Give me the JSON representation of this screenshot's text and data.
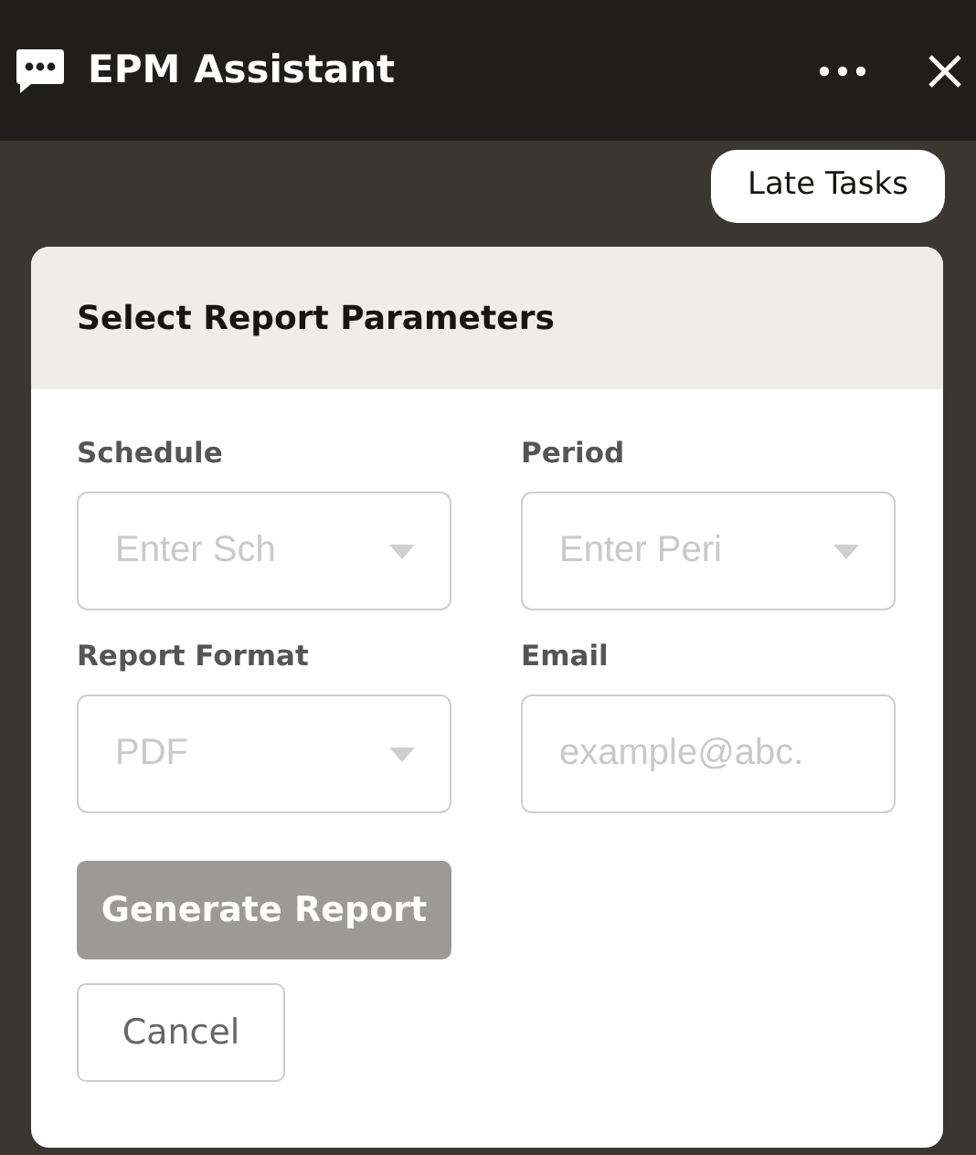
{
  "header": {
    "title": "EPM Assistant"
  },
  "chips": [
    {
      "label": "Late Tasks"
    }
  ],
  "form": {
    "title": "Select Report Parameters",
    "fields": [
      {
        "kind": "select",
        "label": "Schedule",
        "placeholder": "Enter Sch"
      },
      {
        "kind": "select",
        "label": "Period",
        "placeholder": "Enter Peri"
      },
      {
        "kind": "select",
        "label": "Report Format",
        "placeholder": "PDF"
      },
      {
        "kind": "input",
        "label": "Email",
        "placeholder": "example@abc."
      }
    ],
    "buttons": [
      {
        "kind": "primary",
        "label": "Generate Report",
        "disabled": true
      },
      {
        "kind": "outline",
        "label": "Cancel",
        "disabled": false
      }
    ]
  }
}
